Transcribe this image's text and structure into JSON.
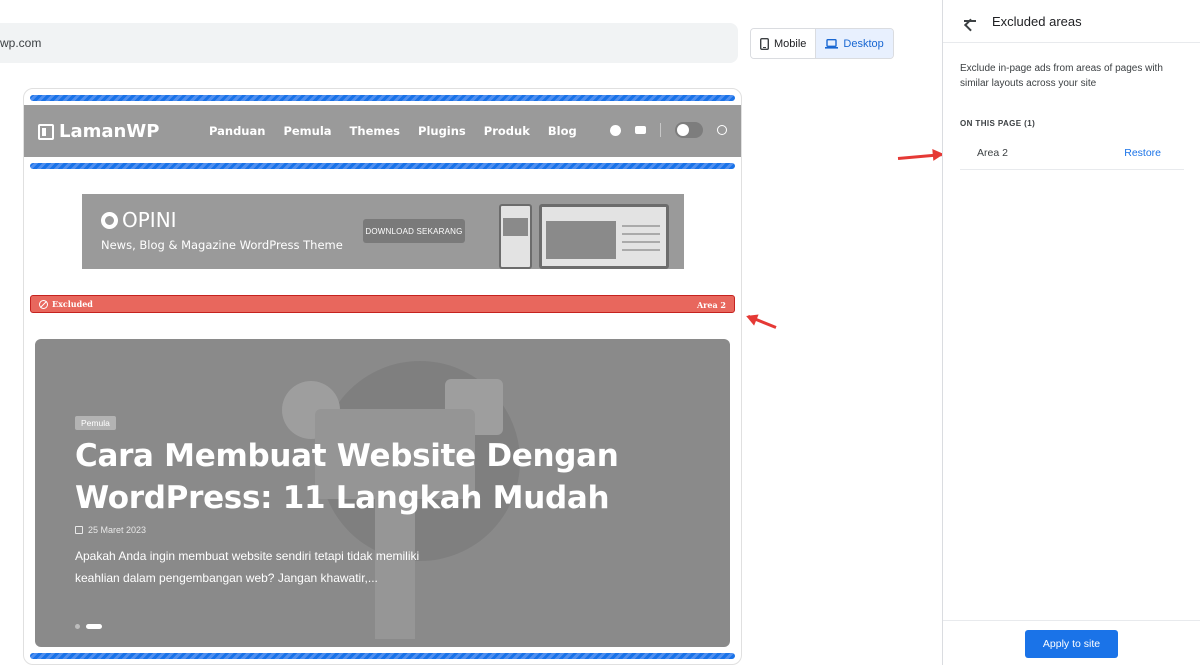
{
  "url_bar": {
    "text": "wp.com"
  },
  "device_toggle": {
    "mobile_label": "Mobile",
    "desktop_label": "Desktop",
    "selected": "Desktop"
  },
  "site": {
    "logo": "LamanWP",
    "nav": [
      "Panduan",
      "Pemula",
      "Themes",
      "Plugins",
      "Produk",
      "Blog"
    ],
    "icons": [
      "facebook-icon",
      "youtube-icon",
      "dark-mode-toggle",
      "search-icon"
    ]
  },
  "banner_ad": {
    "brand": "OPINI",
    "tagline": "News, Blog & Magazine WordPress Theme",
    "cta": "DOWNLOAD SEKARANG"
  },
  "excluded_bar": {
    "label": "Excluded",
    "area": "Area 2"
  },
  "hero": {
    "category": "Pemula",
    "title": "Cara Membuat Website Dengan WordPress: 11 Langkah Mudah",
    "date": "25 Maret 2023",
    "excerpt": "Apakah Anda ingin membuat website sendiri tetapi tidak memiliki keahlian dalam pengembangan web? Jangan khawatir,..."
  },
  "panel": {
    "title": "Excluded areas",
    "description": "Exclude in-page ads from areas of pages with similar layouts across your site",
    "section_label": "ON THIS PAGE (1)",
    "areas": [
      {
        "name": "Area 2",
        "action": "Restore"
      }
    ],
    "apply_label": "Apply to site"
  },
  "colors": {
    "accent": "#1a73e8",
    "excluded": "#e8675d",
    "annotation": "#e53935"
  }
}
